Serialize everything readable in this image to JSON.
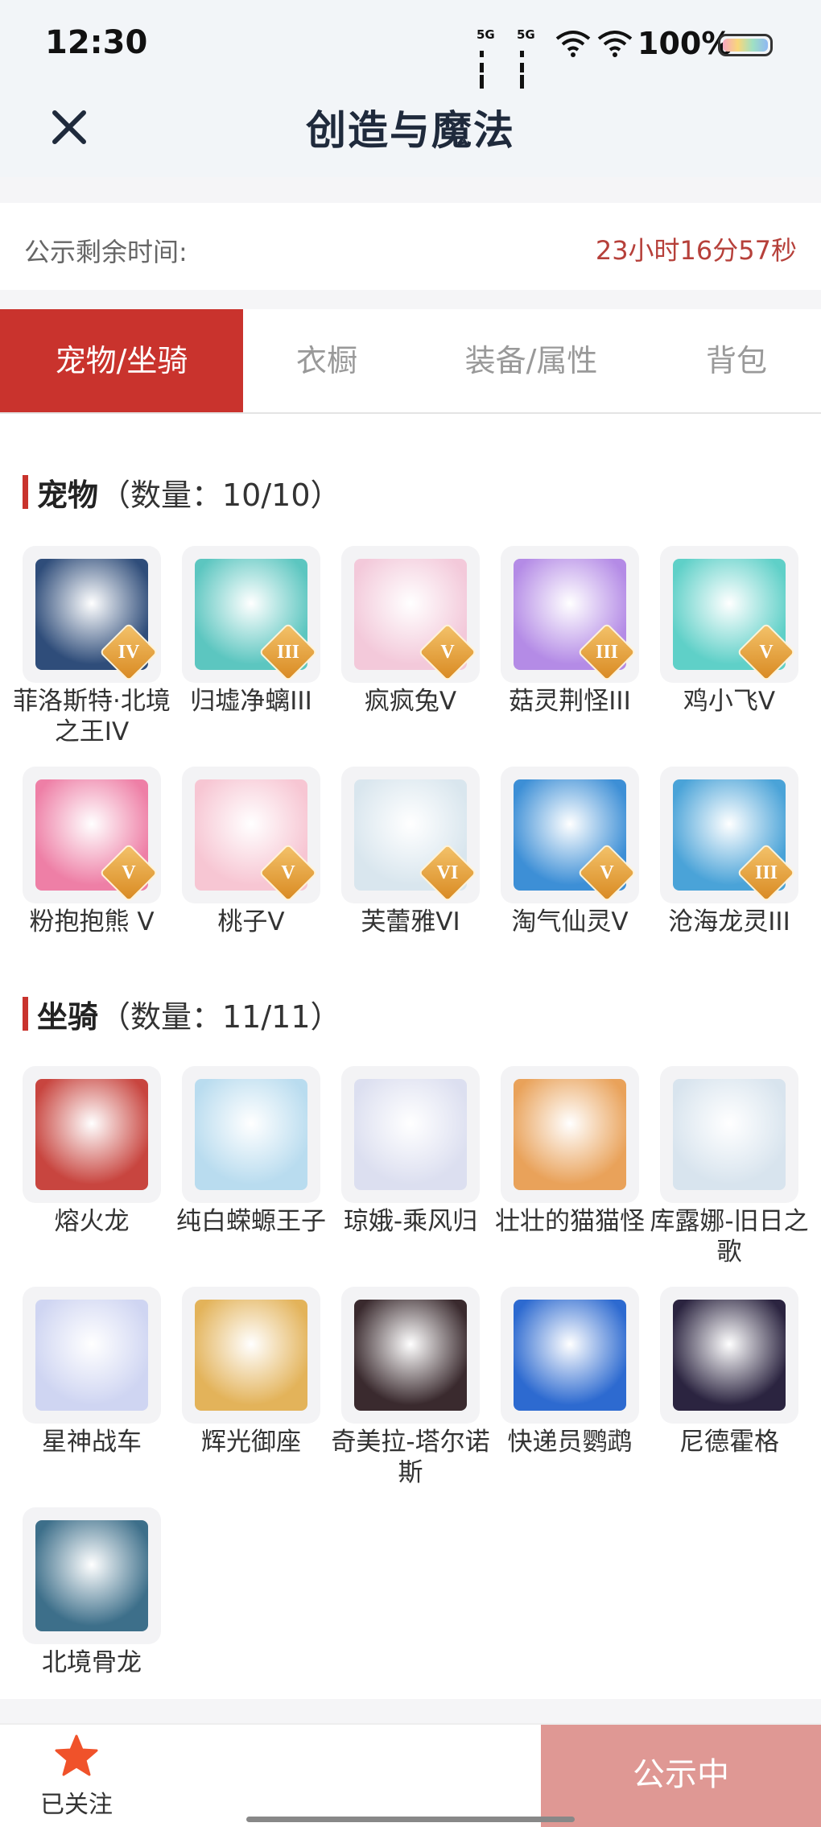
{
  "status_bar": {
    "time": "12:30",
    "net1": "5G",
    "net2": "5G",
    "battery": "100%"
  },
  "header": {
    "title": "创造与魔法"
  },
  "timer": {
    "label": "公示剩余时间:",
    "value": "23小时16分57秒"
  },
  "tabs": [
    {
      "label": "宠物/坐骑",
      "active": true
    },
    {
      "label": "衣橱",
      "active": false
    },
    {
      "label": "装备/属性",
      "active": false
    },
    {
      "label": "背包",
      "active": false
    }
  ],
  "pets": {
    "title": "宠物",
    "count": "（数量：10/10）",
    "items": [
      {
        "name": "菲洛斯特·北境之王IV",
        "grade": "IV",
        "icon": "ice-king-portrait",
        "color": "#2f4d7a"
      },
      {
        "name": "归墟净螭III",
        "grade": "III",
        "icon": "jade-dragon-portrait",
        "color": "#5cc6c0"
      },
      {
        "name": "疯疯兔V",
        "grade": "V",
        "icon": "bunny-portrait",
        "color": "#f3c9da"
      },
      {
        "name": "菇灵荆怪III",
        "grade": "III",
        "icon": "mushroom-sprite-portrait",
        "color": "#b48be6"
      },
      {
        "name": "鸡小飞V",
        "grade": "V",
        "icon": "chick-portrait",
        "color": "#5fd0c8"
      },
      {
        "name": "粉抱抱熊 V",
        "grade": "V",
        "icon": "pink-bear-portrait",
        "color": "#ee7fa6"
      },
      {
        "name": "桃子V",
        "grade": "V",
        "icon": "fox-girl-portrait",
        "color": "#f7c6d3"
      },
      {
        "name": "芙蕾雅VI",
        "grade": "VI",
        "icon": "goddess-portrait",
        "color": "#d9e6ee"
      },
      {
        "name": "淘气仙灵V",
        "grade": "V",
        "icon": "blue-pup-portrait",
        "color": "#3d8fd6"
      },
      {
        "name": "沧海龙灵III",
        "grade": "III",
        "icon": "sea-dragon-girl-portrait",
        "color": "#4aa3d8"
      }
    ]
  },
  "mounts": {
    "title": "坐骑",
    "count": "（数量：11/11）",
    "items": [
      {
        "name": "熔火龙",
        "icon": "fire-dragon-portrait",
        "color": "#c8453f"
      },
      {
        "name": "纯白蝾螈王子",
        "icon": "salamander-prince-portrait",
        "color": "#b9dcef"
      },
      {
        "name": "琼娥-乘风归",
        "icon": "moon-lady-portrait",
        "color": "#dcdff0"
      },
      {
        "name": "壮壮的猫猫怪",
        "icon": "chubby-cat-portrait",
        "color": "#e9a25a"
      },
      {
        "name": "库露娜-旧日之歌",
        "icon": "cloud-girl-portrait",
        "color": "#d8e4ee"
      },
      {
        "name": "星神战车",
        "icon": "star-chariot-portrait",
        "color": "#cfd5f2"
      },
      {
        "name": "辉光御座",
        "icon": "golden-throne-portrait",
        "color": "#e3b35a"
      },
      {
        "name": "奇美拉-塔尔诺斯",
        "icon": "chimera-portrait",
        "color": "#3a2a2e"
      },
      {
        "name": "快递员鹦鹉",
        "icon": "courier-parrot-portrait",
        "color": "#2d6ad0"
      },
      {
        "name": "尼德霍格",
        "icon": "dark-dragon-portrait",
        "color": "#2b2440"
      },
      {
        "name": "北境骨龙",
        "icon": "bone-dragon-portrait",
        "color": "#3d6f8a"
      }
    ]
  },
  "bottom_bar": {
    "follow_label": "已关注",
    "status_button": "公示中"
  },
  "colors": {
    "accent": "#c9332d",
    "timer": "#b6403a",
    "star": "#f0522a",
    "disabled_button": "#df9894"
  }
}
